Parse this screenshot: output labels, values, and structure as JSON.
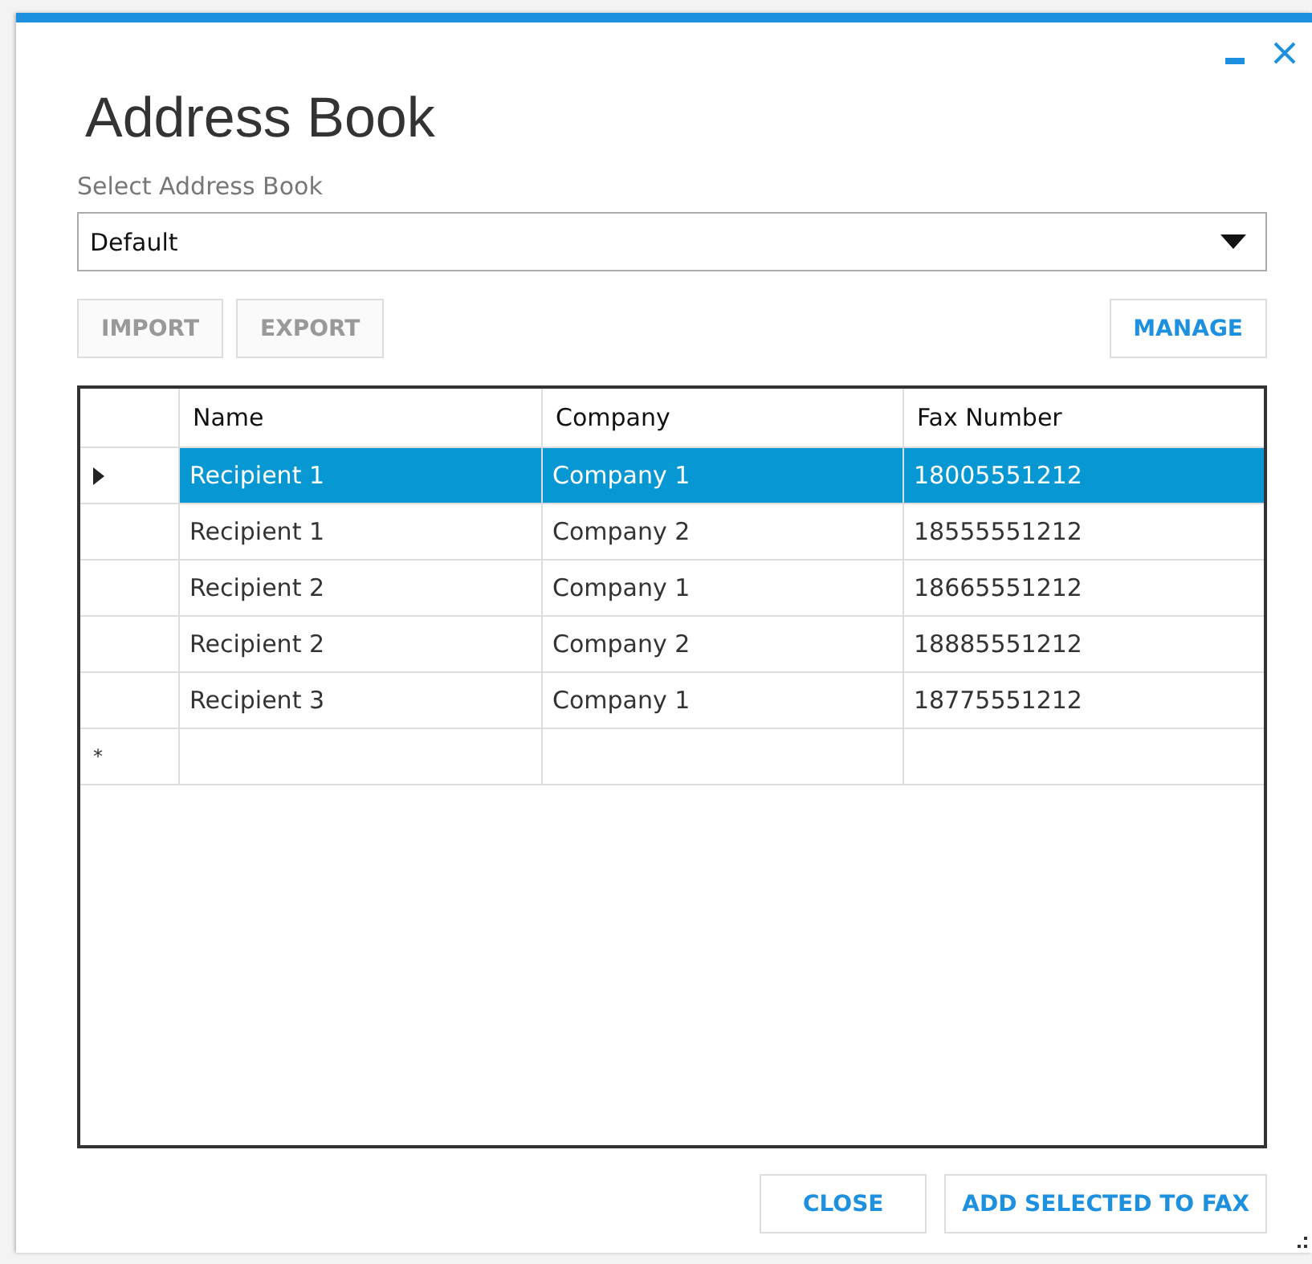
{
  "window": {
    "title": "Address Book"
  },
  "address_book": {
    "label": "Select Address Book",
    "value": "Default"
  },
  "toolbar": [
    {
      "label": "IMPORT",
      "disabled": true
    },
    {
      "label": "EXPORT",
      "disabled": true
    },
    {
      "label": "MANAGE",
      "disabled": false
    }
  ],
  "table": {
    "columns": [
      "Name",
      "Company",
      "Fax Number"
    ],
    "rows": [
      {
        "cells": [
          "Recipient 1",
          "Company 1",
          "18005551212"
        ],
        "selected": true,
        "current": true
      },
      {
        "cells": [
          "Recipient 1",
          "Company 2",
          "18555551212"
        ],
        "selected": false,
        "current": false
      },
      {
        "cells": [
          "Recipient 2",
          "Company 1",
          "18665551212"
        ],
        "selected": false,
        "current": false
      },
      {
        "cells": [
          "Recipient 2",
          "Company 2",
          "18885551212"
        ],
        "selected": false,
        "current": false
      },
      {
        "cells": [
          "Recipient 3",
          "Company 1",
          "18775551212"
        ],
        "selected": false,
        "current": false
      }
    ],
    "new_row_marker": "*"
  },
  "footer_buttons": [
    "CLOSE",
    "ADD SELECTED TO FAX"
  ]
}
